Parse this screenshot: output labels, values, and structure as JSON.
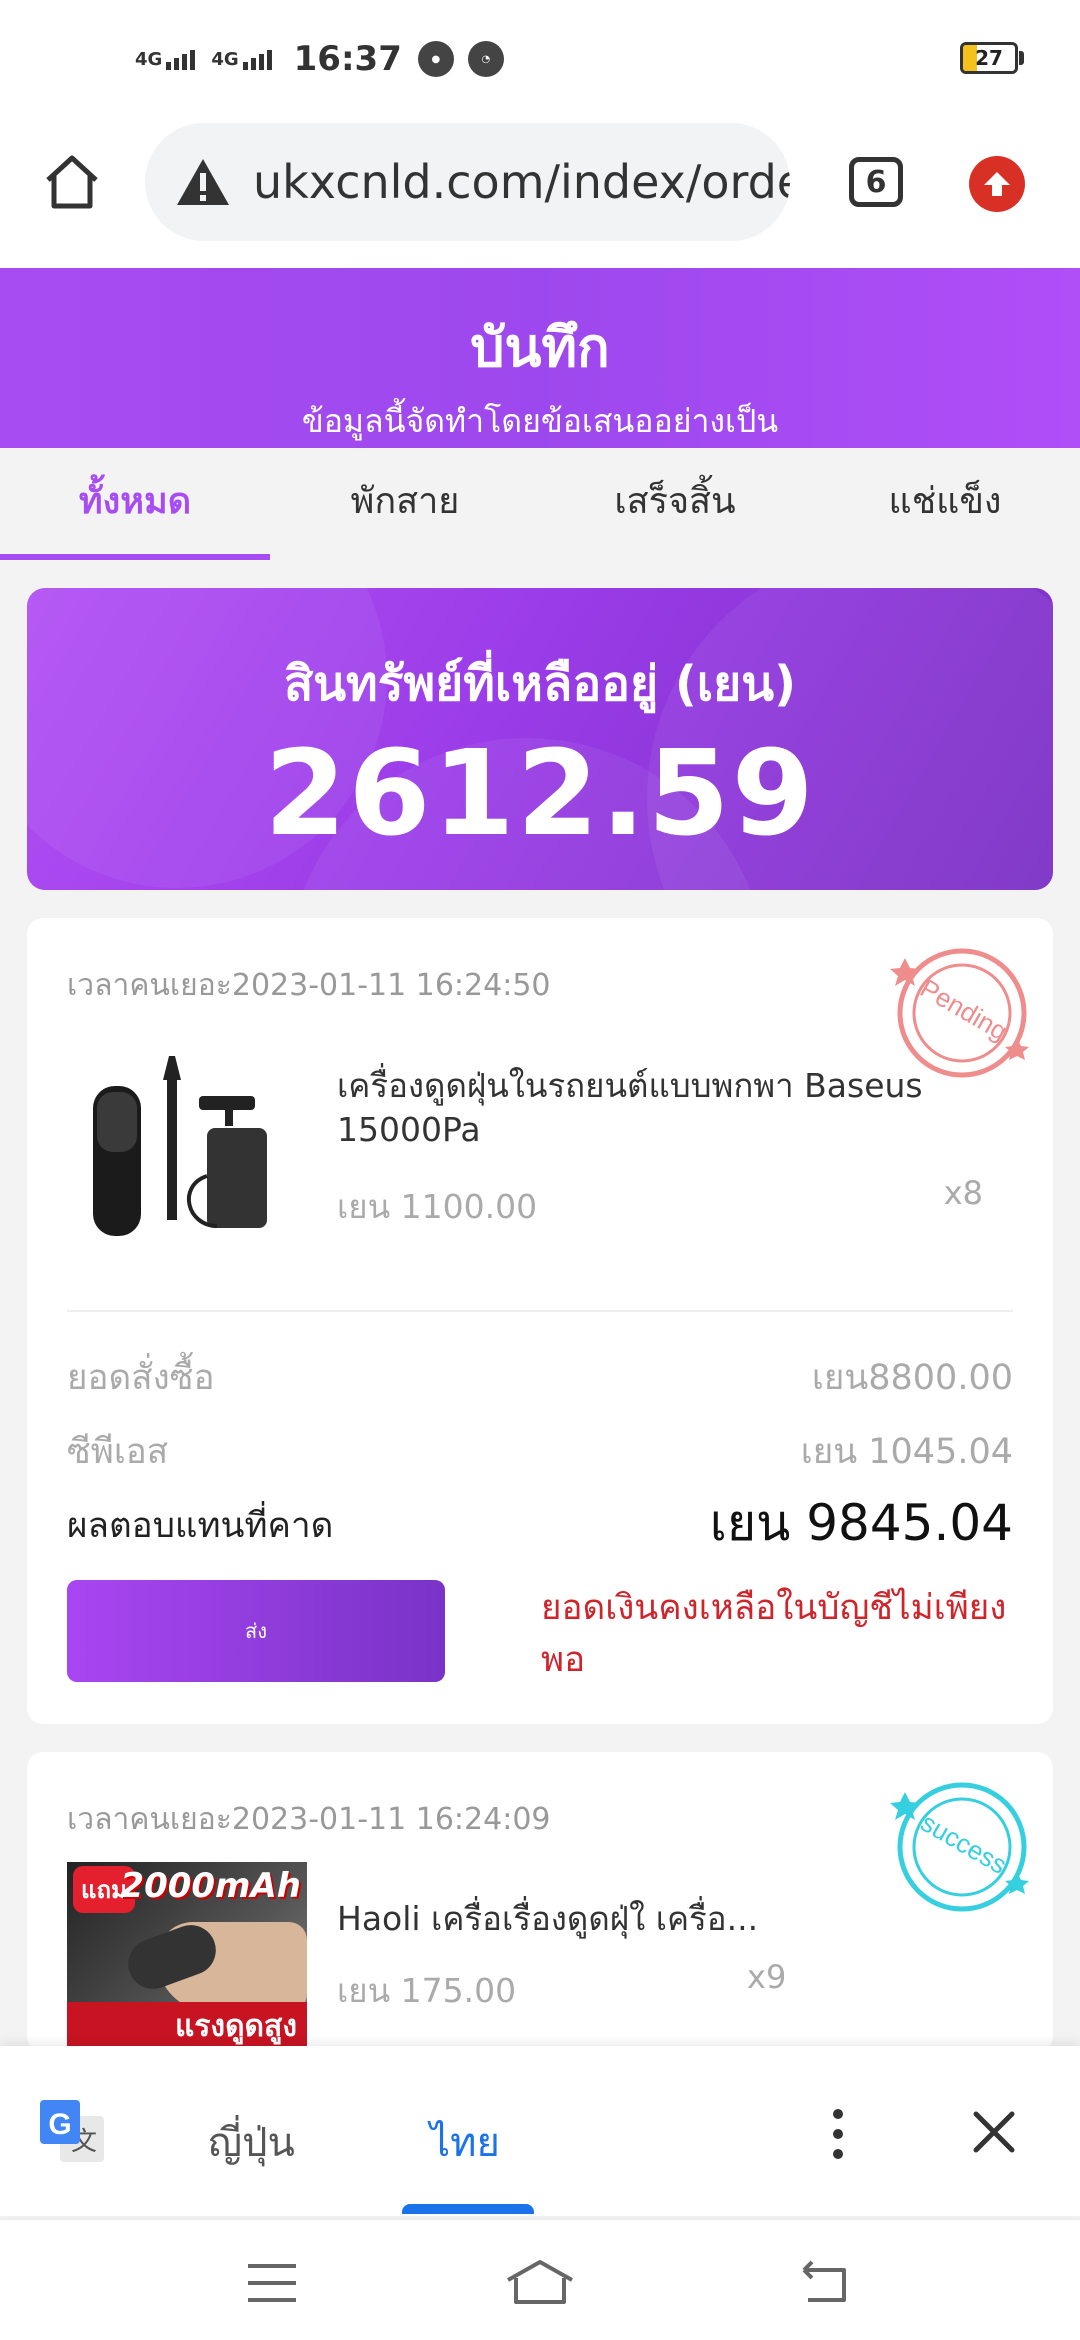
{
  "status_bar": {
    "net1": "4G",
    "net2": "4G",
    "time": "16:37",
    "battery": "27"
  },
  "browser": {
    "url": "ukxcnld.com/index/orde",
    "tab_count": "6"
  },
  "header": {
    "title": "บันทึก",
    "subtitle": "ข้อมูลนี้จัดทำโดยข้อเสนออย่างเป็น"
  },
  "tabs": [
    {
      "label": "ทั้งหมด"
    },
    {
      "label": "พักสาย"
    },
    {
      "label": "เสร็จสิ้น"
    },
    {
      "label": "แช่แข็ง"
    }
  ],
  "balance": {
    "label": "สินทรัพย์ที่เหลืออยู่ (เยน)",
    "value": "2612.59"
  },
  "orders": [
    {
      "time": "เวลาคนเยอะ2023-01-11 16:24:50",
      "stamp": "Pending",
      "product_name": "เครื่องดูดฝุ่นในรถยนต์แบบพกพา Baseus 15000Pa",
      "price": "เยน 1100.00",
      "qty": "x8",
      "order_total_label": "ยอดสั่งซื้อ",
      "order_total_value": "เยน8800.00",
      "cps_label": "ซีพีเอส",
      "cps_value": "เยน 1045.04",
      "expected_label": "ผลตอบแทนที่คาด",
      "expected_value": "เยน 9845.04",
      "submit_label": "ส่ง",
      "warning": "ยอดเงินคงเหลือในบัญชีไม่เพียงพอ"
    },
    {
      "time": "เวลาคนเยอะ2023-01-11 16:24:09",
      "stamp": "success",
      "product_name": "Haoli เครื่อเรื่องดูดฝุ่ใ เครื่อ...",
      "price": "เยน 175.00",
      "qty": "x9",
      "image_badge": "แถม",
      "image_mah": "2000mAh",
      "image_bottom": "แรงดูดสูง"
    }
  ],
  "translate_bar": {
    "source_lang": "ญี่ปุ่น",
    "target_lang": "ไทย"
  },
  "colors": {
    "accent": "#a64cf2",
    "warning": "#d0242b",
    "translate_blue": "#1a73e8"
  }
}
